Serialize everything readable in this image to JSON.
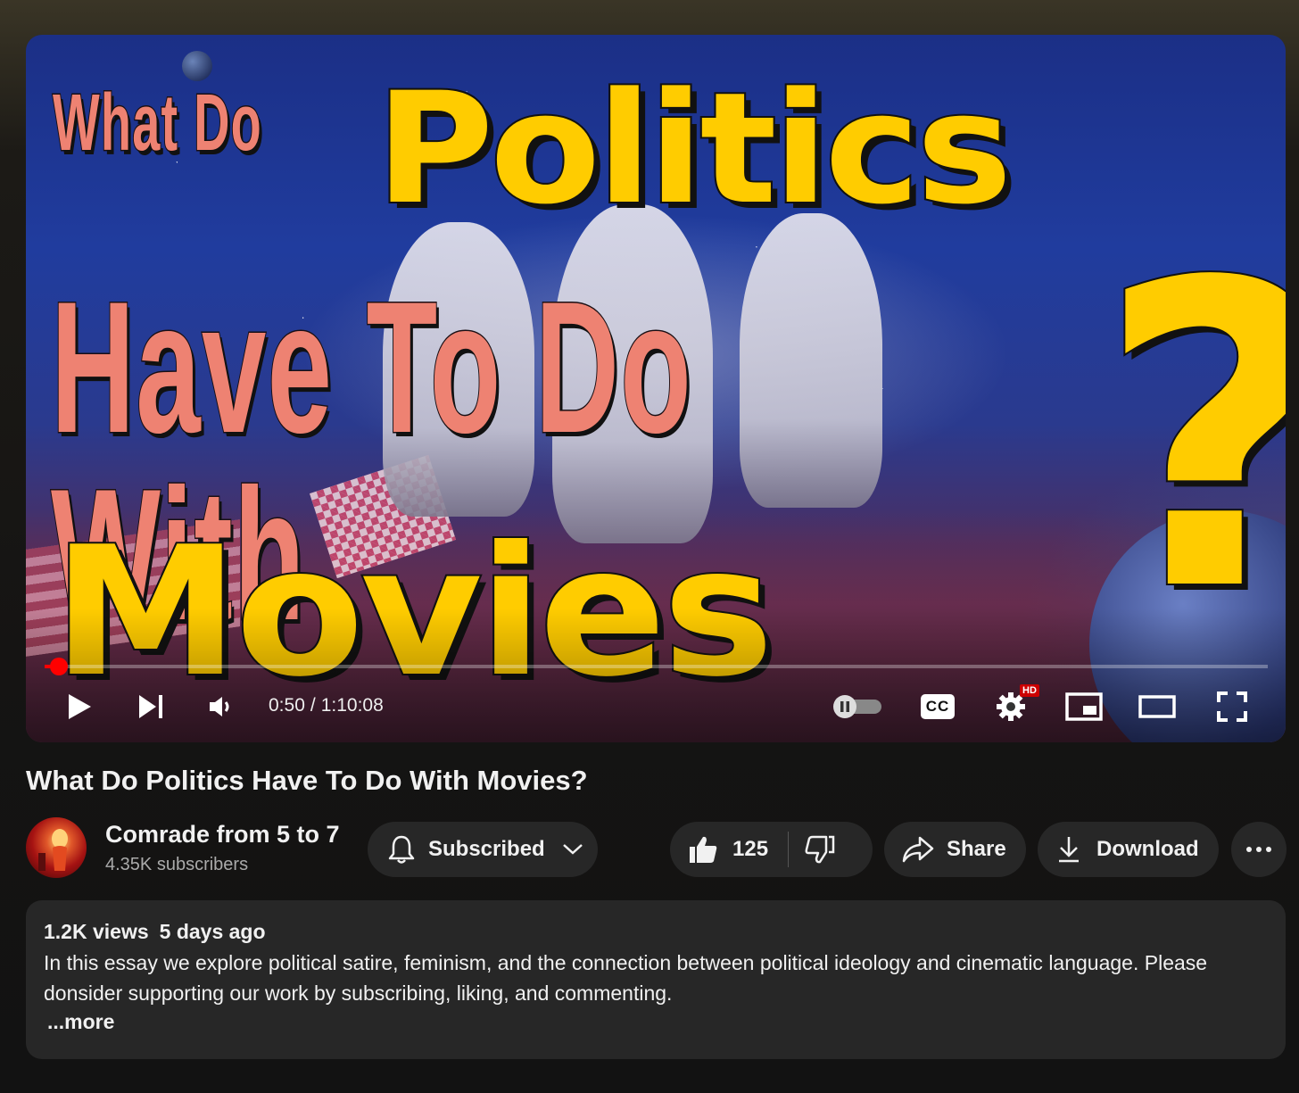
{
  "player": {
    "thumbnail_text": {
      "line1_a": "What Do",
      "line1_b": "Politics",
      "line2": "Have To Do With",
      "line3": "Movies",
      "question_mark": "?"
    },
    "progress_fraction": 0.012,
    "current_time": "0:50",
    "separator": "/",
    "duration": "1:10:08",
    "hd_badge": "HD",
    "cc_label": "CC",
    "icons": {
      "play": "play-icon",
      "next": "next-icon",
      "volume": "volume-icon",
      "autoplay": "autoplay-toggle-icon",
      "captions": "captions-icon",
      "settings": "gear-icon",
      "miniplayer": "miniplayer-icon",
      "theater": "theater-mode-icon",
      "fullscreen": "fullscreen-icon"
    },
    "colors": {
      "progress": "#ff0000"
    }
  },
  "video": {
    "title": "What Do Politics Have To Do With Movies?"
  },
  "channel": {
    "name": "Comrade from 5 to 7",
    "subscribers": "4.35K subscribers",
    "subscribe_label": "Subscribed"
  },
  "actions": {
    "like_count": "125",
    "share_label": "Share",
    "download_label": "Download"
  },
  "description": {
    "views": "1.2K views",
    "age": "5 days ago",
    "text": "In this essay we explore political satire, feminism, and the connection between political ideology and cinematic language. Please donsider supporting our work by subscribing, liking, and commenting.",
    "more_label": "...more"
  }
}
